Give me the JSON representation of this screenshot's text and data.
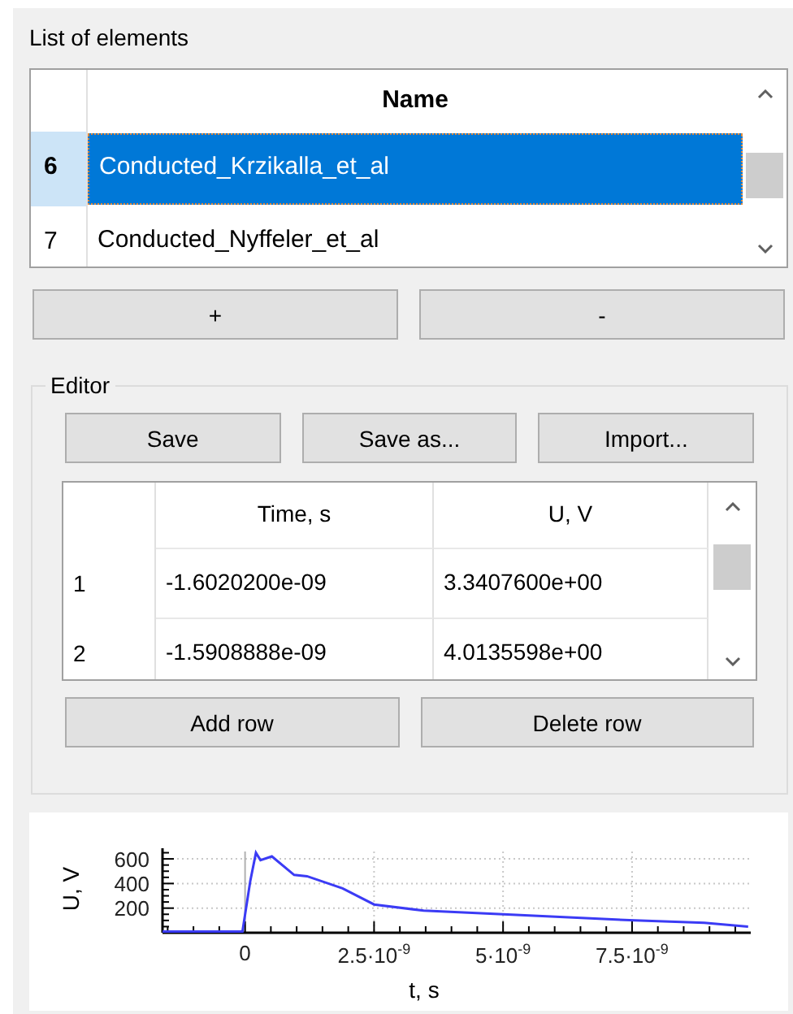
{
  "list_panel": {
    "title": "List of elements",
    "table": {
      "columns": [
        "Name"
      ],
      "rows": [
        {
          "index": "6",
          "name": "Conducted_Krzikalla_et_al",
          "selected": true
        },
        {
          "index": "7",
          "name": "Conducted_Nyffeler_et_al",
          "selected": false
        }
      ]
    },
    "buttons": [
      "+",
      "-"
    ]
  },
  "editor": {
    "title": "Editor",
    "buttons": [
      "Save",
      "Save as...",
      "Import..."
    ],
    "table": {
      "columns": [
        "Time, s",
        "U, V"
      ],
      "rows": [
        {
          "index": "1",
          "cells": [
            "-1.6020200e-09",
            "3.3407600e+00"
          ]
        },
        {
          "index": "2",
          "cells": [
            "-1.5908888e-09",
            "4.0135598e+00"
          ]
        }
      ]
    },
    "row_buttons": [
      "Add row",
      "Delete row"
    ]
  },
  "plot": {
    "chart_data": {
      "type": "line",
      "xlabel": "t, s",
      "ylabel": "U, V",
      "xlim": [
        -1.6e-09,
        9.8e-09
      ],
      "ylim": [
        0,
        660
      ],
      "grid": true,
      "xticks": [
        {
          "value": 0,
          "label": "0"
        },
        {
          "value": 2.5e-09,
          "label": "2.5·10$^{-9}$"
        },
        {
          "value": 5e-09,
          "label": "5·10$^{-9}$"
        },
        {
          "value": 7.5e-09,
          "label": "7.5·10$^{-9}$"
        }
      ],
      "yticks": [
        200,
        400,
        600
      ],
      "series": [
        {
          "color": "#3b3bf5",
          "x": [
            -1.6e-09,
            -5e-11,
            1e-10,
            2.1e-10,
            3e-10,
            5.2e-10,
            9.5e-10,
            1.2e-09,
            1.89e-09,
            2.5e-09,
            3.46e-09,
            5e-09,
            7.55e-09,
            8.9e-09,
            9.75e-09
          ],
          "values": [
            10,
            10,
            420,
            650,
            590,
            620,
            470,
            460,
            360,
            230,
            180,
            150,
            100,
            80,
            50
          ]
        }
      ]
    }
  }
}
